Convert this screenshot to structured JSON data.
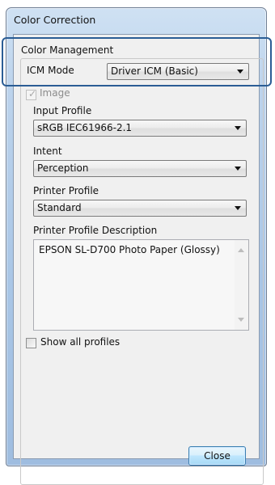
{
  "window": {
    "title": "Color Correction"
  },
  "color_management": {
    "group_label": "Color Management",
    "icm_mode_label": "ICM Mode",
    "icm_mode_value": "Driver ICM (Basic)"
  },
  "image": {
    "checkbox_label": "Image",
    "checked": true,
    "enabled": false
  },
  "input_profile": {
    "label": "Input Profile",
    "value": "sRGB IEC61966-2.1"
  },
  "intent": {
    "label": "Intent",
    "value": "Perception"
  },
  "printer_profile": {
    "label": "Printer Profile",
    "value": "Standard"
  },
  "printer_profile_description": {
    "label": "Printer Profile Description",
    "text": "EPSON SL-D700 Photo Paper (Glossy)"
  },
  "show_all_profiles": {
    "label": "Show all profiles",
    "checked": false
  },
  "buttons": {
    "close": "Close"
  },
  "colors": {
    "highlight": "#2b5d95",
    "window_frame": "#a9c6e6",
    "client_bg": "#f0f0f0"
  },
  "icons": {
    "dropdown_arrow": "chevron-down-icon",
    "scroll_up": "scroll-up-icon",
    "scroll_down": "scroll-down-icon"
  }
}
